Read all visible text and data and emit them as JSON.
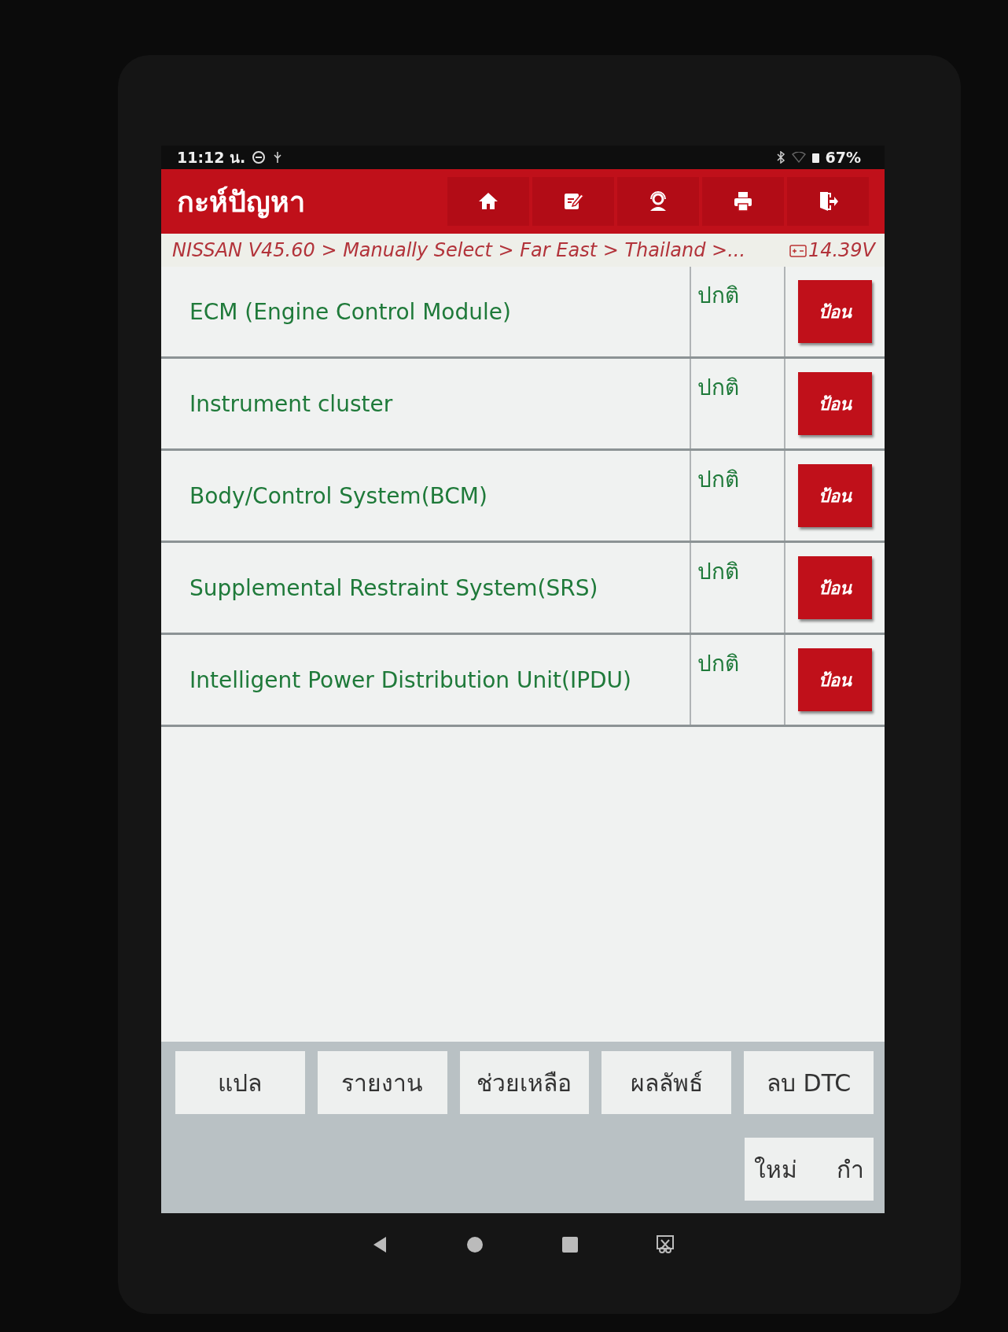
{
  "status_bar": {
    "time": "11:12 น.",
    "battery": "67%"
  },
  "header": {
    "title": "กะห์ปัญหา",
    "tools": [
      {
        "kind": "home"
      },
      {
        "kind": "edit"
      },
      {
        "kind": "support"
      },
      {
        "kind": "print"
      },
      {
        "kind": "exit"
      }
    ]
  },
  "breadcrumb": {
    "path": "NISSAN V45.60 > Manually Select > Far East > Thailand >...",
    "voltage": "14.39V"
  },
  "systems": [
    {
      "name": "ECM (Engine Control Module)",
      "status": "ปกติ",
      "action": "ป้อน"
    },
    {
      "name": "Instrument cluster",
      "status": "ปกติ",
      "action": "ป้อน"
    },
    {
      "name": "Body/Control System(BCM)",
      "status": "ปกติ",
      "action": "ป้อน"
    },
    {
      "name": "Supplemental Restraint System(SRS)",
      "status": "ปกติ",
      "action": "ป้อน"
    },
    {
      "name": "Intelligent Power Distribution Unit(IPDU)",
      "status": "ปกติ",
      "action": "ป้อน"
    }
  ],
  "buttons": [
    "แปล",
    "รายงาน",
    "ช่วยเหลือ",
    "ผลลัพธ์",
    "ลบ DTC"
  ],
  "extra_button": {
    "label_parts": [
      "ใหม่",
      "กำ"
    ]
  },
  "nav_bar": [
    {
      "kind": "back"
    },
    {
      "kind": "home"
    },
    {
      "kind": "recents"
    },
    {
      "kind": "screenshot"
    }
  ]
}
